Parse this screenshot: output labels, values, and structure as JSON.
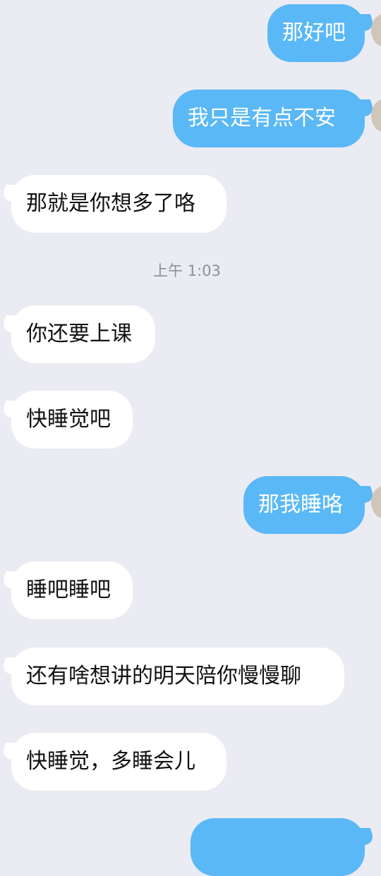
{
  "messages": [
    {
      "side": "out",
      "text": "那好吧"
    },
    {
      "side": "out",
      "text": "我只是有点不安"
    },
    {
      "side": "in",
      "text": "那就是你想多了咯"
    },
    {
      "side": "in",
      "text": "你还要上课"
    },
    {
      "side": "in",
      "text": "快睡觉吧"
    },
    {
      "side": "out",
      "text": "那我睡咯"
    },
    {
      "side": "in",
      "text": "睡吧睡吧"
    },
    {
      "side": "in",
      "text": "还有啥想讲的明天陪你慢慢聊"
    },
    {
      "side": "in",
      "text": "快睡觉，多睡会儿"
    },
    {
      "side": "out",
      "text": ""
    }
  ],
  "timestamp": "上午 1:03",
  "colors": {
    "background": "#ebebf3",
    "outgoing_bubble": "#5ab8f6",
    "incoming_bubble": "#ffffff",
    "timestamp_text": "#8e8e96"
  }
}
